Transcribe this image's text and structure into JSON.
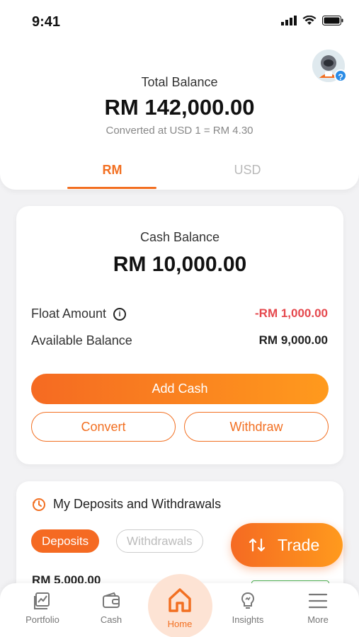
{
  "status_bar": {
    "time": "9:41"
  },
  "header": {
    "total_label": "Total Balance",
    "total_value": "RM 142,000.00",
    "conversion": "Converted at USD 1 = RM 4.30",
    "tabs": [
      "RM",
      "USD"
    ],
    "active_tab": "RM",
    "help_badge": "?"
  },
  "cash": {
    "label": "Cash Balance",
    "value": "RM 10,000.00",
    "float_label": "Float Amount",
    "float_value": "-RM 1,000.00",
    "available_label": "Available Balance",
    "available_value": "RM 9,000.00",
    "add_label": "Add Cash",
    "convert_label": "Convert",
    "withdraw_label": "Withdraw",
    "info_glyph": "i"
  },
  "deposits": {
    "title": "My Deposits and Withdrawals",
    "chips": [
      "Deposits",
      "Withdrawals"
    ],
    "active_chip": "Deposits",
    "first_amount": "RM 5,000.00"
  },
  "trade_button": {
    "label": "Trade"
  },
  "bottom_nav": {
    "items": [
      {
        "label": "Portfolio",
        "icon": "portfolio-icon"
      },
      {
        "label": "Cash",
        "icon": "wallet-icon"
      },
      {
        "label": "Home",
        "icon": "home-icon"
      },
      {
        "label": "Insights",
        "icon": "insights-icon"
      },
      {
        "label": "More",
        "icon": "menu-icon"
      }
    ],
    "active": "Home"
  },
  "colors": {
    "accent": "#f26f21",
    "negative": "#e5484d",
    "positive": "#4caf50"
  }
}
